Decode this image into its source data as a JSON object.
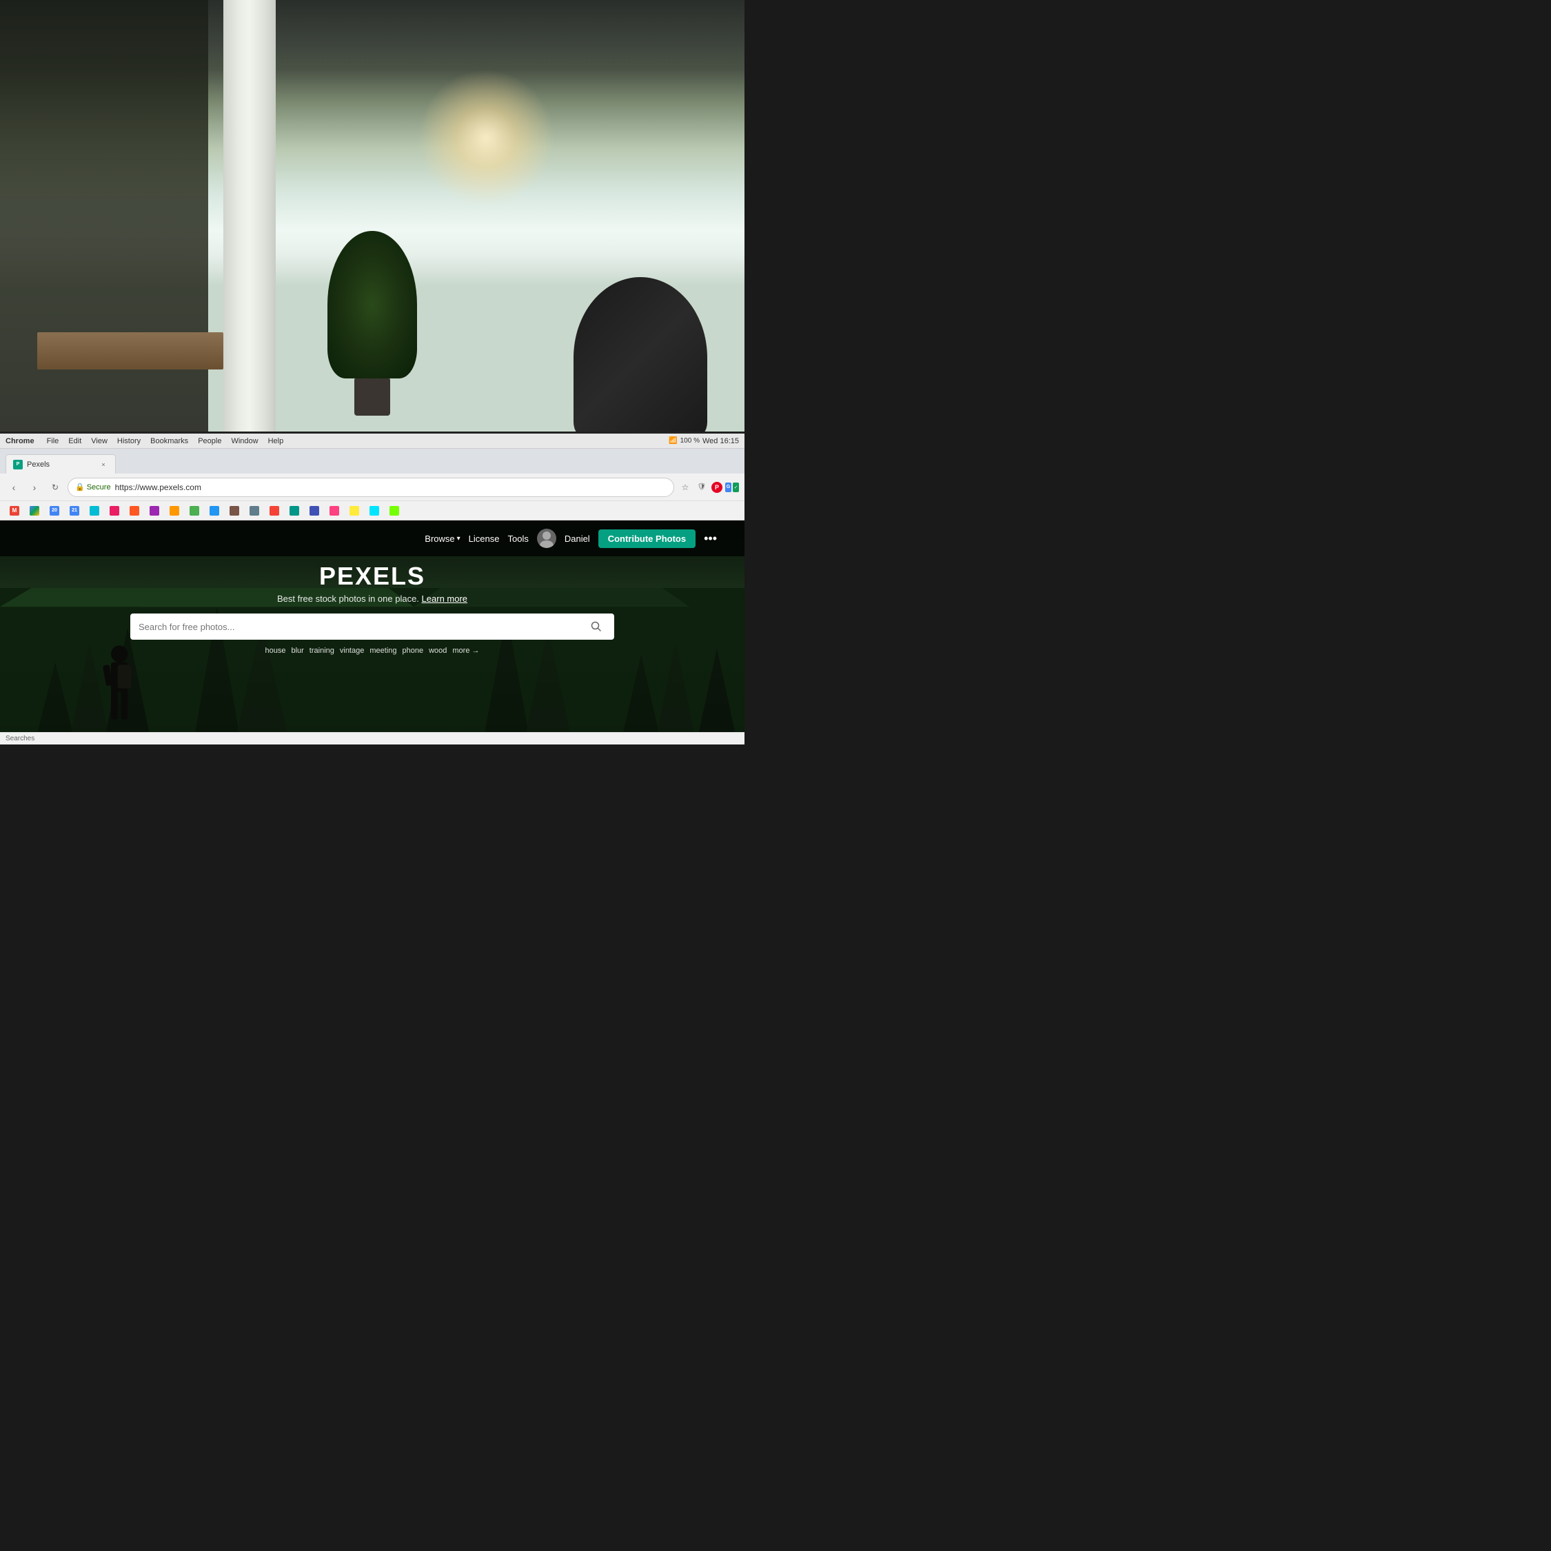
{
  "background": {
    "alt": "Office background photo with blurred foreground"
  },
  "menubar": {
    "app": "Chrome",
    "items": [
      "File",
      "Edit",
      "View",
      "History",
      "Bookmarks",
      "People",
      "Window",
      "Help"
    ],
    "time": "Wed 16:15",
    "battery": "100 %"
  },
  "browser": {
    "tab": {
      "title": "Pexels",
      "favicon_color": "#05a081"
    },
    "address": {
      "secure_label": "Secure",
      "url": "https://www.pexels.com"
    },
    "close_icon": "×"
  },
  "pexels": {
    "nav": {
      "browse_label": "Browse",
      "license_label": "License",
      "tools_label": "Tools",
      "user_name": "Daniel",
      "contribute_label": "Contribute Photos",
      "more_icon": "•••"
    },
    "hero": {
      "title": "PEXELS",
      "tagline": "Best free stock photos in one place.",
      "learn_more": "Learn more",
      "search_placeholder": "Search for free photos...",
      "suggestions": [
        "house",
        "blur",
        "training",
        "vintage",
        "meeting",
        "phone",
        "wood"
      ],
      "more_label": "more →"
    }
  },
  "statusbar": {
    "text": "Searches"
  }
}
